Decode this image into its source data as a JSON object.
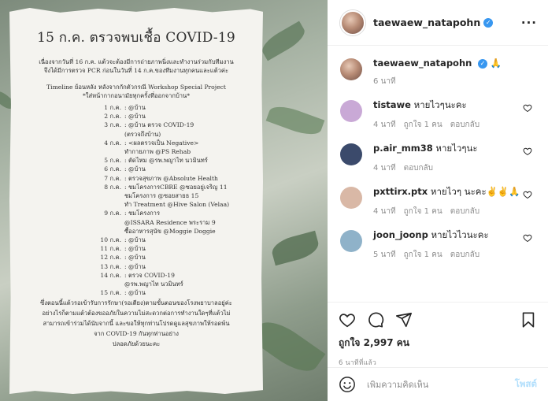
{
  "post_image": {
    "title": "15 ก.ค. ตรวจพบเชื้อ COVID-19",
    "intro": [
      "เนื่องจากวันที่ 16 ก.ค. แต้วจะต้องมีการถ่ายภาพนิ่งและทำงานร่วมกับทีมงาน",
      "จึงได้มีการตรวจ PCR ก่อนในวันที่ 14 ก.ค.ของทีมงานทุกคนและแต้วค่ะ"
    ],
    "timeline_head": [
      "Timeline ย้อนหลัง หลังจากกักตัวกรณี Workshop Special Project",
      "*ใส่หน้ากากอนามัยทุกครั้งที่ออกจากบ้าน*"
    ],
    "timeline": [
      {
        "date": "1 ก.ค.",
        "text": ": @บ้าน"
      },
      {
        "date": "2 ก.ค.",
        "text": ": @บ้าน"
      },
      {
        "date": "3 ก.ค.",
        "text": ": @บ้าน ตรวจ COVID-19"
      },
      {
        "date": "",
        "text": "(ตรวจถึงบ้าน)"
      },
      {
        "date": "4 ก.ค.",
        "text": ": <ผลตรวจเป็น Negative>"
      },
      {
        "date": "",
        "text": "ทำกายภาพ @PS Rehab"
      },
      {
        "date": "5 ก.ค.",
        "text": ": ตัดไหม @รพ.พญาไท นวมินทร์"
      },
      {
        "date": "6 ก.ค.",
        "text": ": @บ้าน"
      },
      {
        "date": "7 ก.ค.",
        "text": ": ตรวจสุขภาพ @Absolute Health"
      },
      {
        "date": "8 ก.ค.",
        "text": ": ชมโครงการCBRE @ซอยอยู่เจริญ 11"
      },
      {
        "date": "",
        "text": "ชมโครงการ @ซอยสายธ 15"
      },
      {
        "date": "",
        "text": "ทำ Treatment @Hive Salon (Velaa)"
      },
      {
        "date": "9 ก.ค.",
        "text": ": ชมโครงการ"
      },
      {
        "date": "",
        "text": "@ISSARA Residence พระราม 9"
      },
      {
        "date": "",
        "text": "ซื้ออาหารสุนัข @Moggie Doggie"
      },
      {
        "date": "10 ก.ค.",
        "text": ": @บ้าน"
      },
      {
        "date": "11 ก.ค.",
        "text": ": @บ้าน"
      },
      {
        "date": "12 ก.ค.",
        "text": ": @บ้าน"
      },
      {
        "date": "13 ก.ค.",
        "text": ": @บ้าน"
      },
      {
        "date": "14 ก.ค.",
        "text": ": ตรวจ COVID-19"
      },
      {
        "date": "",
        "text": "@รพ.พญาไท นวมินทร์"
      },
      {
        "date": "15 ก.ค.",
        "text": ": @บ้าน"
      }
    ],
    "outro": [
      "ซึ่งตอนนี้แต้วรอเข้ารับการรักษา(รอเตียง)ตามขั้นตอนของโรงพยาบาลอยู่ค่ะ",
      "อย่างไรก็ตามแต้วต้องขออภัยในความไม่สะดวกต่อการทำงานใดๆที่แต้วไม่",
      "สามารถเข้าร่วมได้นับจากนี้ และขอให้ทุกท่านโปรดดูแลสุขภาพให้รอดพ้น",
      "จาก COVID-19 กันทุกท่านอย่าง",
      "ปลอดภัยด้วยนะคะ"
    ]
  },
  "header": {
    "username": "taewaew_natapohn",
    "more_label": "···"
  },
  "caption": {
    "username": "taewaew_natapohn",
    "text": "🙏",
    "time": "6 นาที"
  },
  "comments": [
    {
      "username": "tistawe",
      "text": "หายไวๆนะคะ",
      "time": "4 นาที",
      "likes": "ถูกใจ 1 คน",
      "reply": "ตอบกลับ",
      "avatar_color": "#c9a9d6"
    },
    {
      "username": "p.air_mm38",
      "text": "หายไวๆนะ",
      "time": "4 นาที",
      "likes": "",
      "reply": "ตอบกลับ",
      "avatar_color": "#3b4a6b"
    },
    {
      "username": "pxttirx.ptx",
      "text": "หายไวๆ นะคะ✌️✌️🙏",
      "time": "4 นาที",
      "likes": "ถูกใจ 1 คน",
      "reply": "ตอบกลับ",
      "avatar_color": "#d9b8a6"
    },
    {
      "username": "joon_joonp",
      "text": "หายไวไวนะคะ",
      "time": "5 นาที",
      "likes": "ถูกใจ 1 คน",
      "reply": "ตอบกลับ",
      "avatar_color": "#8fb2c9"
    }
  ],
  "actions": {
    "likes": "ถูกใจ 2,997 คน",
    "timestamp": "6 นาทีที่แล้ว"
  },
  "comment_box": {
    "placeholder": "เพิ่มความคิดเห็น",
    "post_label": "โพสต์"
  },
  "colors": {
    "verified": "#3897f0",
    "post_button": "#b2dffc",
    "meta_text": "#8e8e8e"
  }
}
